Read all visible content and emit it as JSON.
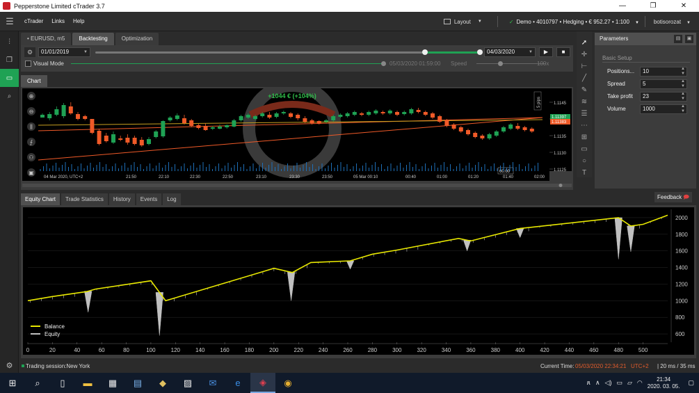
{
  "window": {
    "title": "Pepperstone Limited cTrader 3.7",
    "buttons": [
      "—",
      "❐",
      "✕"
    ]
  },
  "menu": {
    "items": [
      "cTrader",
      "Links",
      "Help"
    ],
    "layout_label": "Layout",
    "account": "Demo • 4010797 • Hedging • € 952.27 • 1:100",
    "user": "botisorozat"
  },
  "tabs": [
    {
      "label": "EURUSD, m5"
    },
    {
      "label": "Backtesting"
    },
    {
      "label": "Optimization"
    }
  ],
  "backtest": {
    "start_date": "01/01/2019",
    "end_date": "04/03/2020",
    "visual_mode_label": "Visual Mode",
    "visual_time": "05/03/2020 01:59:00",
    "speed_label": "Speed",
    "speed_value": "100x",
    "progress": 0.86
  },
  "chart": {
    "tab": "Chart",
    "profit_banner": "+1044 € (+104%)",
    "price_labels": [
      "1.1145",
      "1.1140",
      "1.1135",
      "1.1130",
      "1.1125"
    ],
    "price_tags": [
      "1.11397",
      "1.11383"
    ],
    "time_labels": [
      "04 Mar 2020, UTC+2",
      "21:50",
      "22:10",
      "22:30",
      "22:50",
      "23:10",
      "23:30",
      "23:50",
      "05 Mar 00:10",
      "00:40",
      "01:00",
      "01:20",
      "01:40",
      "02:00"
    ],
    "cursor_time": "00:00",
    "pips_label": "5 pips",
    "colors": {
      "up": "#1fa254",
      "down": "#f05a28"
    }
  },
  "tools": [
    "cursor-icon",
    "crosshair-icon",
    "measure-icon",
    "line-icon",
    "pencil-icon",
    "pattern-icon",
    "fib-icon",
    "dots-icon",
    "grid-icon",
    "rect-icon",
    "circle-icon",
    "text-icon"
  ],
  "params": {
    "header": "Parameters",
    "section": "Basic Setup",
    "rows": [
      {
        "label": "Positions...",
        "value": "10"
      },
      {
        "label": "Spread",
        "value": "5"
      },
      {
        "label": "Take profit",
        "value": "23"
      },
      {
        "label": "Volume",
        "value": "1000"
      }
    ]
  },
  "bottom_tabs": [
    "Equity Chart",
    "Trade Statistics",
    "History",
    "Events",
    "Log"
  ],
  "feedback_label": "Feedback",
  "chart_data": {
    "type": "line",
    "xlim": [
      0,
      520
    ],
    "ylim": [
      500,
      2100
    ],
    "x_ticks": [
      0,
      20,
      40,
      60,
      80,
      100,
      120,
      140,
      160,
      180,
      200,
      220,
      240,
      260,
      280,
      300,
      320,
      340,
      360,
      380,
      400,
      420,
      440,
      460,
      480,
      500
    ],
    "y_ticks": [
      600,
      800,
      1000,
      1200,
      1400,
      1600,
      1800,
      2000
    ],
    "legend": [
      "Balance",
      "Equity"
    ],
    "legend_position": "bottom-left",
    "series": [
      {
        "name": "Balance",
        "color": "#e8e800",
        "x": [
          0,
          20,
          48,
          55,
          100,
          112,
          200,
          215,
          230,
          262,
          280,
          300,
          350,
          360,
          400,
          480,
          490,
          500,
          520
        ],
        "y": [
          1000,
          1050,
          1110,
          1140,
          1240,
          1000,
          1390,
          1340,
          1460,
          1480,
          1560,
          1610,
          1750,
          1720,
          1870,
          2000,
          1900,
          1920,
          2030
        ]
      },
      {
        "name": "Equity",
        "color": "#c0c0c0",
        "spikes": [
          {
            "x": 49,
            "y": 860
          },
          {
            "x": 107,
            "y": 580
          },
          {
            "x": 214,
            "y": 1000
          },
          {
            "x": 262,
            "y": 1380
          },
          {
            "x": 357,
            "y": 1600
          },
          {
            "x": 400,
            "y": 1760
          },
          {
            "x": 480,
            "y": 1500
          },
          {
            "x": 490,
            "y": 1590
          }
        ]
      }
    ]
  },
  "status": {
    "session": "Trading session:New York",
    "current_time_label": "Current Time:",
    "current_time": "05/03/2020 22:34:21",
    "timezone": "UTC+2",
    "latency": "| 20 ms / 35 ms"
  },
  "taskbar": {
    "time": "21:34",
    "date": "2020. 03. 05."
  }
}
